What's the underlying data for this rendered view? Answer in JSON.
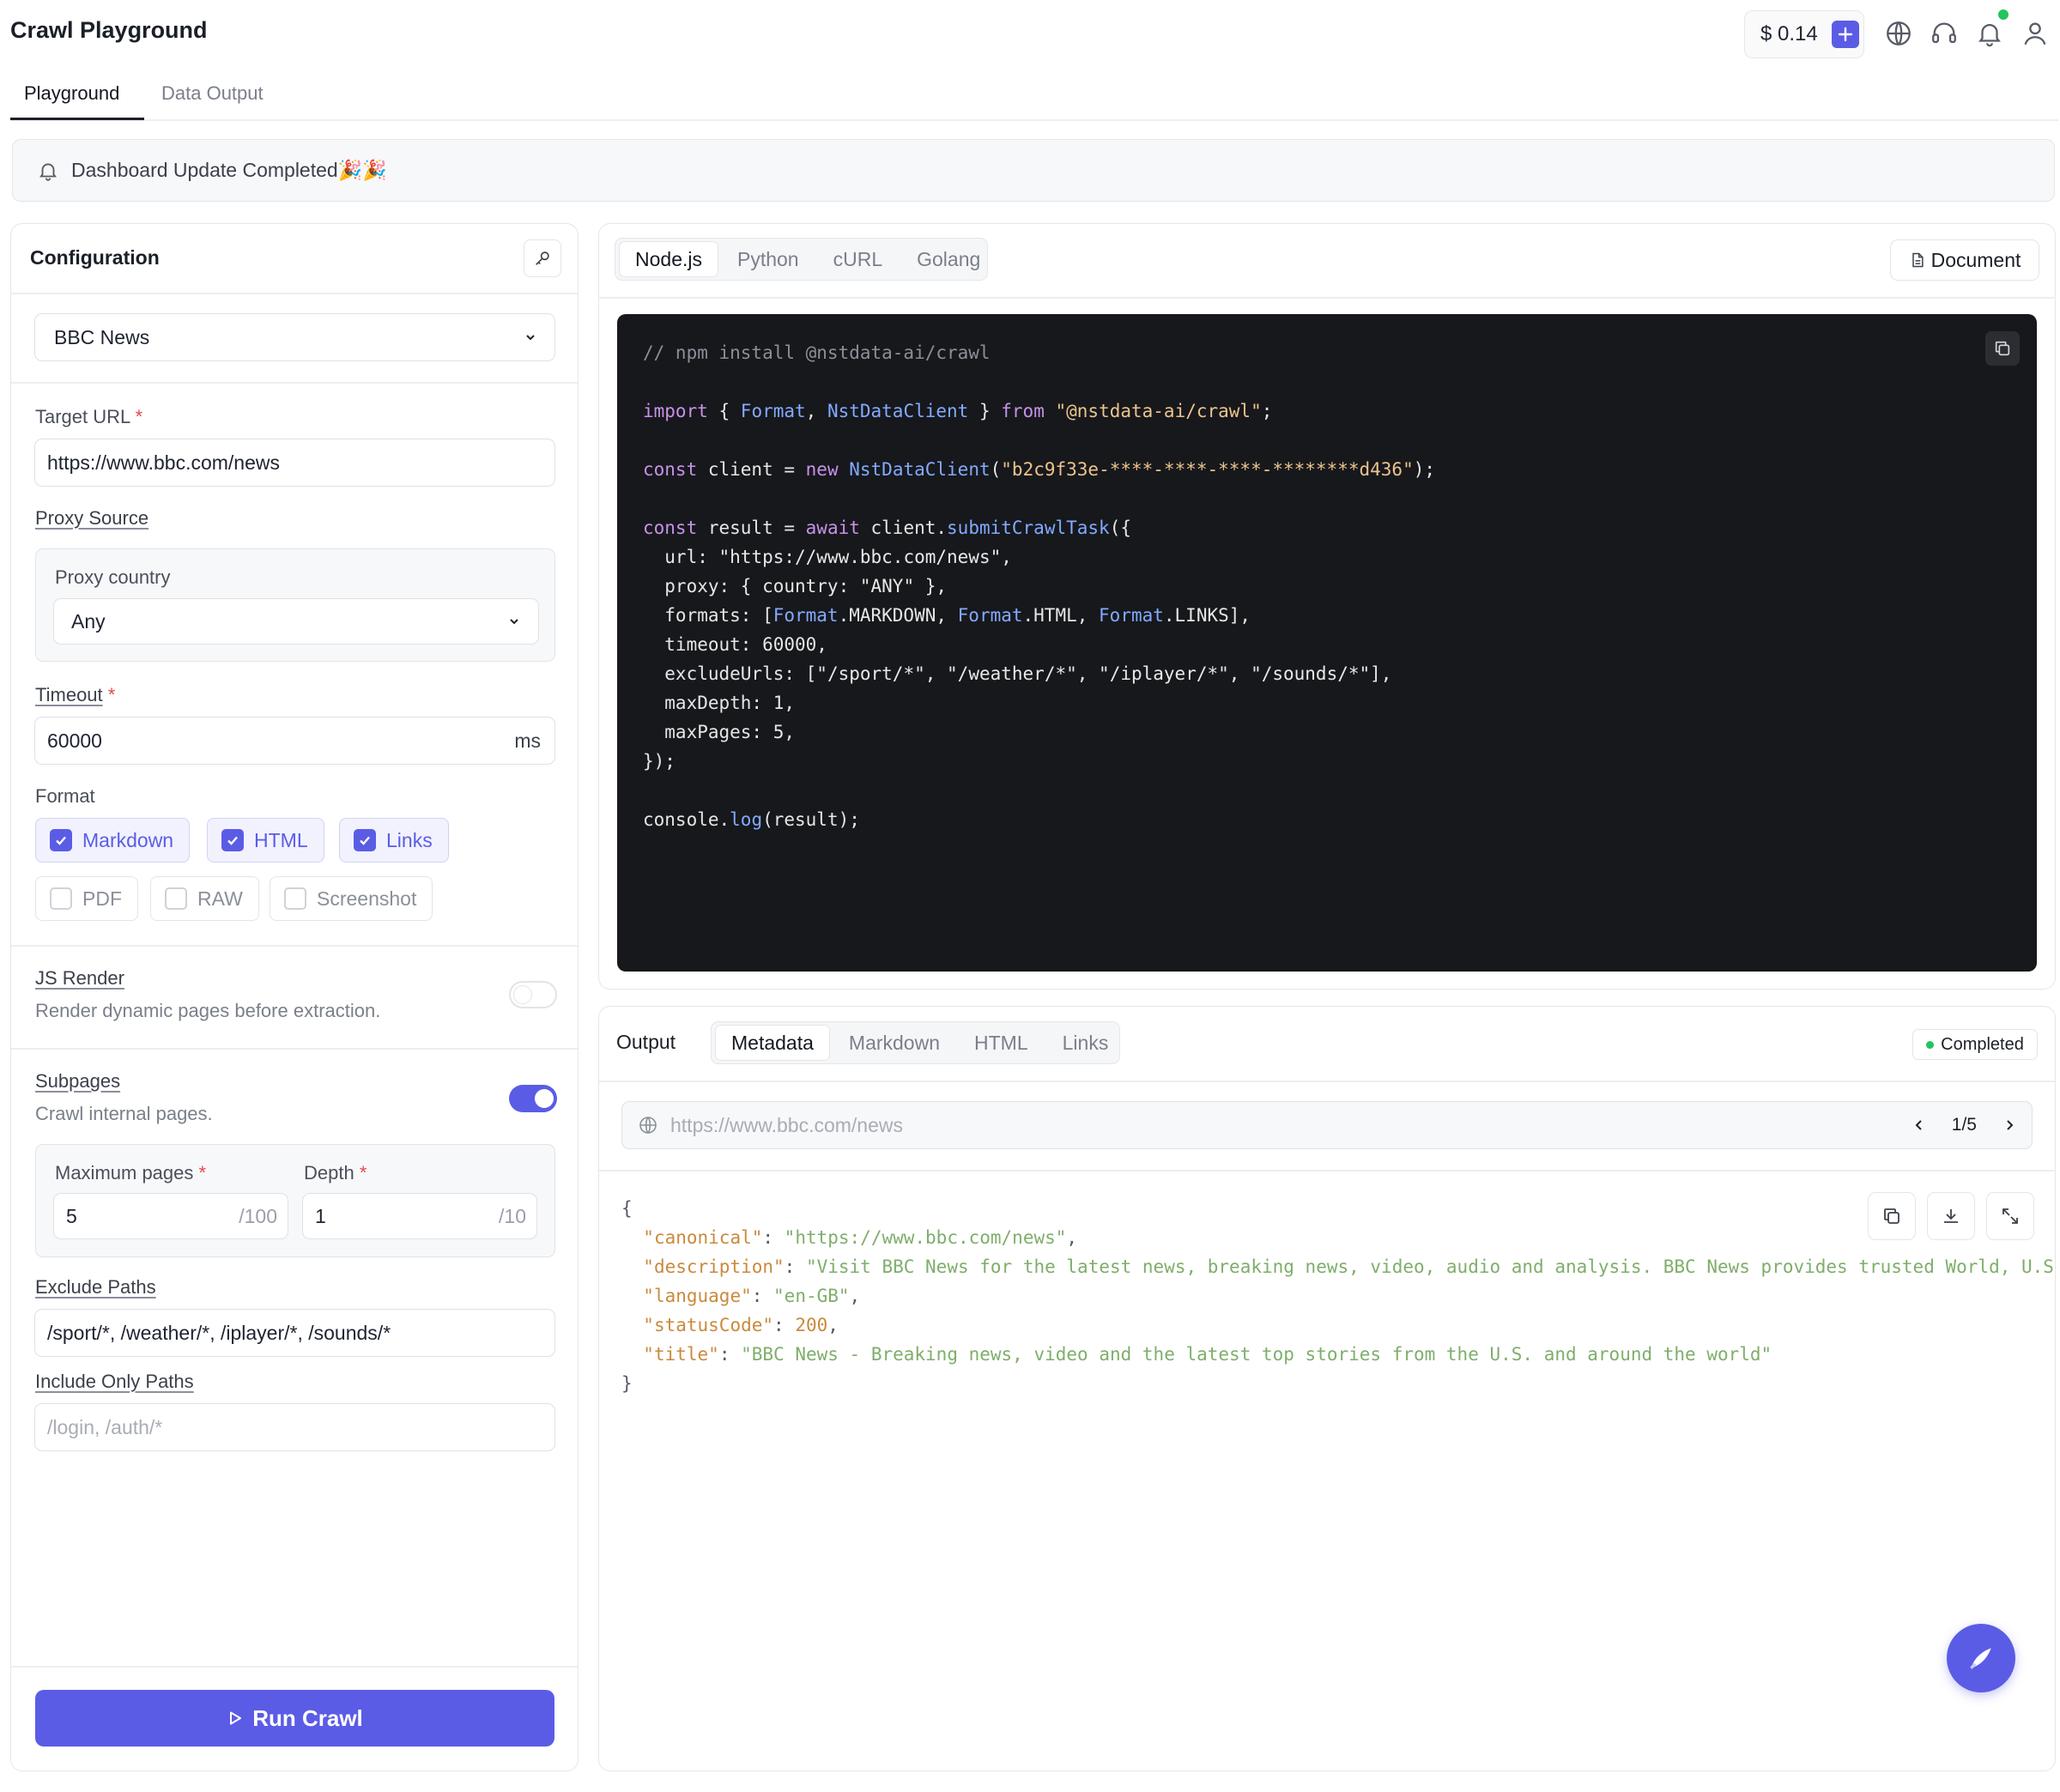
{
  "app": {
    "title": "Crawl Playground"
  },
  "header": {
    "balance": "$ 0.14",
    "icons": [
      "globe-icon",
      "headset-icon",
      "bell-icon",
      "user-icon"
    ]
  },
  "tabs": [
    "Playground",
    "Data Output"
  ],
  "banner": {
    "text": "Dashboard Update Completed🎉🎉"
  },
  "config": {
    "title": "Configuration",
    "preset": "BBC News",
    "target_url_label": "Target URL",
    "target_url": "https://www.bbc.com/news",
    "proxy_source_label": "Proxy Source",
    "proxy_country_label": "Proxy country",
    "proxy_country": "Any",
    "timeout_label": "Timeout",
    "timeout": "60000",
    "timeout_unit": "ms",
    "format_label": "Format",
    "formats": [
      {
        "label": "Markdown",
        "checked": true
      },
      {
        "label": "HTML",
        "checked": true
      },
      {
        "label": "Links",
        "checked": true
      },
      {
        "label": "PDF",
        "checked": false
      },
      {
        "label": "RAW",
        "checked": false
      },
      {
        "label": "Screenshot",
        "checked": false
      }
    ],
    "js_render_label": "JS Render",
    "js_render_desc": "Render dynamic pages before extraction.",
    "js_render_on": false,
    "subpages_label": "Subpages",
    "subpages_desc": "Crawl internal pages.",
    "subpages_on": true,
    "max_pages_label": "Maximum pages",
    "max_pages": "5",
    "max_pages_limit": "/100",
    "depth_label": "Depth",
    "depth": "1",
    "depth_limit": "/10",
    "exclude_label": "Exclude Paths",
    "exclude": "/sport/*, /weather/*, /iplayer/*, /sounds/*",
    "include_label": "Include Only Paths",
    "include_placeholder": "/login, /auth/*",
    "run_label": "Run Crawl"
  },
  "code": {
    "tabs": [
      "Node.js",
      "Python",
      "cURL",
      "Golang"
    ],
    "active_tab": "Node.js",
    "document_label": "Document",
    "lines": [
      "// npm install @nstdata-ai/crawl",
      "",
      "import { Format, NstDataClient } from \"@nstdata-ai/crawl\";",
      "",
      "const client = new NstDataClient(\"b2c9f33e-****-****-****-********d436\");",
      "",
      "const result = await client.submitCrawlTask({",
      "  url: \"https://www.bbc.com/news\",",
      "  proxy: { country: \"ANY\" },",
      "  formats: [Format.MARKDOWN, Format.HTML, Format.LINKS],",
      "  timeout: 60000,",
      "  excludeUrls: [\"/sport/*\", \"/weather/*\", \"/iplayer/*\", \"/sounds/*\"],",
      "  maxDepth: 1,",
      "  maxPages: 5,",
      "});",
      "",
      "console.log(result);"
    ]
  },
  "output": {
    "title": "Output",
    "tabs": [
      "Metadata",
      "Markdown",
      "HTML",
      "Links"
    ],
    "active_tab": "Metadata",
    "status": "Completed",
    "url": "https://www.bbc.com/news",
    "pager": "1/5",
    "json": [
      {
        "key": "canonical",
        "value": "\"https://www.bbc.com/news\""
      },
      {
        "key": "description",
        "value": "\"Visit BBC News for the latest news, breaking news, video, audio and analysis. BBC News provides trusted World, U.S. a"
      },
      {
        "key": "language",
        "value": "\"en-GB\""
      },
      {
        "key": "statusCode",
        "value": "200"
      },
      {
        "key": "title",
        "value": "\"BBC News - Breaking news, video and the latest top stories from the U.S. and around the world\""
      }
    ]
  },
  "colors": {
    "accent": "#5b5ce6",
    "success": "#22c55e",
    "code_bg": "#17181c"
  }
}
